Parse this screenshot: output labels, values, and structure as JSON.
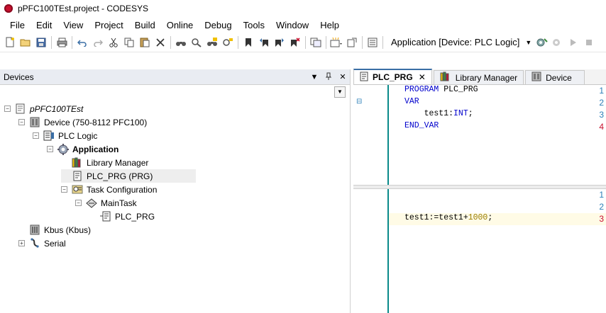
{
  "window": {
    "title": "pPFC100TEst.project - CODESYS"
  },
  "menu": [
    "File",
    "Edit",
    "View",
    "Project",
    "Build",
    "Online",
    "Debug",
    "Tools",
    "Window",
    "Help"
  ],
  "toolbar": {
    "application_selector": "Application [Device: PLC Logic]",
    "buttons": [
      "new-file-icon",
      "open-icon",
      "save-icon",
      "print-icon",
      "undo-icon",
      "redo-icon",
      "cut-icon",
      "copy-icon",
      "paste-icon",
      "delete-icon",
      "find-icon",
      "find-next-icon",
      "replace-icon",
      "replace-next-icon",
      "bookmark-icon",
      "bookmark-prev-icon",
      "bookmark-next-icon",
      "bookmark-clear-icon",
      "cross-reference-icon",
      "add-object-icon",
      "export-icon",
      "calculator-icon"
    ]
  },
  "devices_panel": {
    "title": "Devices",
    "tree": [
      {
        "label": "pPFC100TEst",
        "level": 0,
        "icon": "project-icon",
        "expander": "−",
        "italic": true
      },
      {
        "label": "Device (750-8112 PFC100)",
        "level": 1,
        "icon": "device-icon",
        "expander": "−"
      },
      {
        "label": "PLC Logic",
        "level": 2,
        "icon": "plc-logic-icon",
        "expander": "−"
      },
      {
        "label": "Application",
        "level": 3,
        "icon": "application-gear-icon",
        "expander": "−",
        "bold": true
      },
      {
        "label": "Library Manager",
        "level": 4,
        "icon": "library-icon",
        "expander": ""
      },
      {
        "label": "PLC_PRG (PRG)",
        "level": 4,
        "icon": "program-icon",
        "expander": "",
        "selected": true
      },
      {
        "label": "Task Configuration",
        "level": 4,
        "icon": "task-config-icon",
        "expander": "−"
      },
      {
        "label": "MainTask",
        "level": 5,
        "icon": "task-icon",
        "expander": "−"
      },
      {
        "label": "PLC_PRG",
        "level": 6,
        "icon": "call-icon",
        "expander": ""
      },
      {
        "label": "Kbus (Kbus)",
        "level": 1,
        "icon": "kbus-icon",
        "expander": ""
      },
      {
        "label": "Serial",
        "level": 1,
        "icon": "serial-icon",
        "expander": "+"
      }
    ]
  },
  "editor": {
    "tabs": [
      {
        "label": "PLC_PRG",
        "active": true,
        "closable": true
      },
      {
        "label": "Library Manager",
        "active": false
      },
      {
        "label": "Device",
        "active": false
      }
    ],
    "declaration": {
      "line_numbers": [
        "1",
        "2",
        "3",
        "4"
      ],
      "lines": [
        [
          {
            "t": "PROGRAM ",
            "c": "kw"
          },
          {
            "t": "PLC_PRG",
            "c": ""
          }
        ],
        [
          {
            "t": "VAR",
            "c": "kw"
          }
        ],
        [
          {
            "t": "    test1:",
            "c": ""
          },
          {
            "t": "INT",
            "c": "kw"
          },
          {
            "t": ";",
            "c": ""
          }
        ],
        [
          {
            "t": "END_VAR",
            "c": "kw"
          }
        ]
      ]
    },
    "implementation": {
      "line_numbers": [
        "1",
        "2",
        "3"
      ],
      "lines": [
        [],
        [],
        [
          {
            "t": "test1:=test1+",
            "c": ""
          },
          {
            "t": "1000",
            "c": "num"
          },
          {
            "t": ";",
            "c": ""
          }
        ]
      ]
    }
  }
}
